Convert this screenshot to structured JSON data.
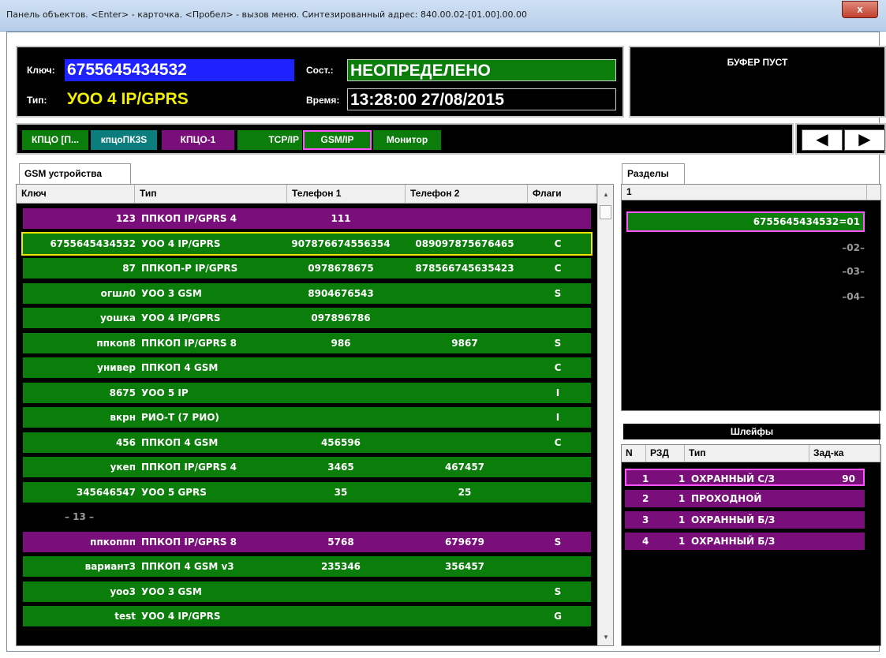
{
  "window": {
    "title": "Панель объектов. <Enter> - карточка. <Пробел> - вызов меню. Синтезированный адрес: 840.00.02-[01.00].00.00",
    "close": "x"
  },
  "header": {
    "key_label": "Ключ:",
    "key_value": "6755645434532",
    "type_label": "Тип:",
    "type_value": "УОО 4 IP/GPRS",
    "state_label": "Сост.:",
    "state_value": "НЕОПРЕДЕЛЕНО",
    "time_label": "Время:",
    "time_value": "13:28:00 27/08/2015",
    "buffer": "БУФЕР ПУСТ"
  },
  "channel_tabs": [
    {
      "label": "КПЦО [П...",
      "color": "#0a7d0a"
    },
    {
      "label": "кпцоПК3S",
      "color": "#0c7d7d"
    },
    {
      "label": "КПЦО-1",
      "color": "#7a0e7a"
    },
    {
      "label": "TCP/IP",
      "color": "#0a7d0a"
    },
    {
      "label": "GSM/IP",
      "color": "#0a7d0a"
    },
    {
      "label": "Монитор",
      "color": "#0a7d0a"
    }
  ],
  "nav": {
    "prev": "◀",
    "next": "▶"
  },
  "left_panel": {
    "tab": "GSM устройства",
    "columns": [
      "Ключ",
      "Тип",
      "Телефон 1",
      "Телефон 2",
      "Флаги"
    ],
    "rows": [
      {
        "key": "123",
        "type": "ППКОП IP/GPRS 4",
        "phone1": "111",
        "phone2": "",
        "flags": "",
        "color": "#7a0e7a"
      },
      {
        "key": "6755645434532",
        "type": "УОО 4 IP/GPRS",
        "phone1": "907876674556354",
        "phone2": "089097875676465",
        "flags": "C",
        "color": "#0a7d0a"
      },
      {
        "key": "87",
        "type": "ППКОП-Р IP/GPRS",
        "phone1": "0978678675",
        "phone2": "878566745635423",
        "flags": "C",
        "color": "#0a7d0a"
      },
      {
        "key": "огшл0",
        "type": "УОО 3 GSM",
        "phone1": "8904676543",
        "phone2": "",
        "flags": "S",
        "color": "#0a7d0a"
      },
      {
        "key": "уошка",
        "type": "УОО 4 IP/GPRS",
        "phone1": "097896786",
        "phone2": "",
        "flags": "",
        "color": "#0a7d0a"
      },
      {
        "key": "ппкоп8",
        "type": "ППКОП IP/GPRS 8",
        "phone1": "986",
        "phone2": "9867",
        "flags": "S",
        "color": "#0a7d0a"
      },
      {
        "key": "универ",
        "type": "ППКОП 4 GSM",
        "phone1": "",
        "phone2": "",
        "flags": "C",
        "color": "#0a7d0a"
      },
      {
        "key": "8675",
        "type": "УОО 5 IP",
        "phone1": "",
        "phone2": "",
        "flags": "I",
        "color": "#0a7d0a"
      },
      {
        "key": "вкрн",
        "type": "РИО-Т (7 РИО)",
        "phone1": "",
        "phone2": "",
        "flags": "I",
        "color": "#0a7d0a"
      },
      {
        "key": "456",
        "type": "ППКОП 4 GSM",
        "phone1": "456596",
        "phone2": "",
        "flags": "C",
        "color": "#0a7d0a"
      },
      {
        "key": "укеп",
        "type": "ППКОП IP/GPRS 4",
        "phone1": "3465",
        "phone2": "467457",
        "flags": "",
        "color": "#0a7d0a"
      },
      {
        "key": "345646547",
        "type": "УОО 5 GPRS",
        "phone1": "35",
        "phone2": "25",
        "flags": "",
        "color": "#0a7d0a"
      },
      {
        "key": "– 13 –",
        "type": "",
        "phone1": "",
        "phone2": "",
        "flags": "",
        "color": ""
      },
      {
        "key": "ппкоппп",
        "type": "ППКОП IP/GPRS 8",
        "phone1": "5768",
        "phone2": "679679",
        "flags": "S",
        "color": "#7a0e7a"
      },
      {
        "key": "вариант3",
        "type": "ППКОП 4 GSM v3",
        "phone1": "235346",
        "phone2": "356457",
        "flags": "",
        "color": "#0a7d0a"
      },
      {
        "key": "уоо3",
        "type": "УОО 3 GSM",
        "phone1": "",
        "phone2": "",
        "flags": "S",
        "color": "#0a7d0a"
      },
      {
        "key": "test",
        "type": "УОО 4 IP/GPRS",
        "phone1": "",
        "phone2": "",
        "flags": "G",
        "color": "#0a7d0a"
      }
    ],
    "selected_index": 1
  },
  "sections_panel": {
    "tab": "Разделы",
    "column": "1",
    "selected": "6755645434532=01",
    "items": [
      "–02–",
      "–03–",
      "–04–"
    ]
  },
  "loops_panel": {
    "title": "Шлейфы",
    "columns": [
      "N",
      "РЗД",
      "Тип",
      "Зад-ка"
    ],
    "rows": [
      {
        "n": "1",
        "rzd": "1",
        "type": "ОХРАННЫЙ С/З",
        "delay": "90"
      },
      {
        "n": "2",
        "rzd": "1",
        "type": "ПРОХОДНОЙ",
        "delay": ""
      },
      {
        "n": "3",
        "rzd": "1",
        "type": "ОХРАННЫЙ Б/З",
        "delay": ""
      },
      {
        "n": "4",
        "rzd": "1",
        "type": "ОХРАННЫЙ Б/З",
        "delay": ""
      }
    ]
  }
}
